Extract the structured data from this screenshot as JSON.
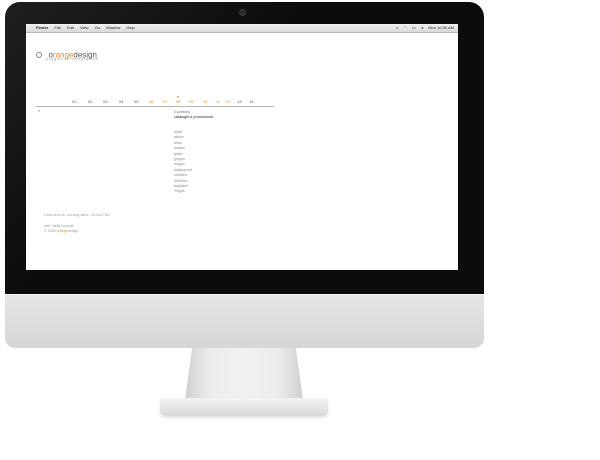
{
  "menubar": {
    "apple_icon": "",
    "items": [
      "Finder",
      "File",
      "Edit",
      "View",
      "Go",
      "Window",
      "Help"
    ],
    "extras_icons": [
      "spotlight-icon",
      "wifi-icon",
      "battery-icon",
      "volume-icon"
    ],
    "clock": "Mon 10:30 AM"
  },
  "site": {
    "logo": {
      "pre": "o",
      "accent": "range",
      "post": "design"
    },
    "tagline": "progettazionegrafica",
    "pager": {
      "pages": [
        "01",
        "02",
        "03",
        "04",
        "05",
        "06",
        "07",
        "08",
        "09",
        "10",
        "11",
        "12",
        "13",
        "14"
      ],
      "orange_pages": [
        "06",
        "07",
        "08",
        "09",
        "10",
        "11",
        "12"
      ],
      "current": "08",
      "arrow": "▼"
    },
    "back_marker": "«",
    "section": {
      "label": "il portfolio",
      "title": "cataloghi e promozione"
    },
    "clients": [
      "Alfa8",
      "album",
      "alma",
      "desidio",
      "gabel",
      "gruppo",
      "magnu",
      "milanopoint",
      "novelles",
      "SIAtumo",
      "trasplant",
      "Ysigns"
    ],
    "resolution_note": "risoluzione consigliata: 1024x768",
    "rights": "tutti i diritti riservati",
    "copyright": {
      "prefix": "© 2005 ",
      "brand_accent": "orange",
      "brand_rest": "design"
    }
  },
  "colors": {
    "accent": "#f08a1c",
    "text": "#555555",
    "muted": "#999999"
  }
}
